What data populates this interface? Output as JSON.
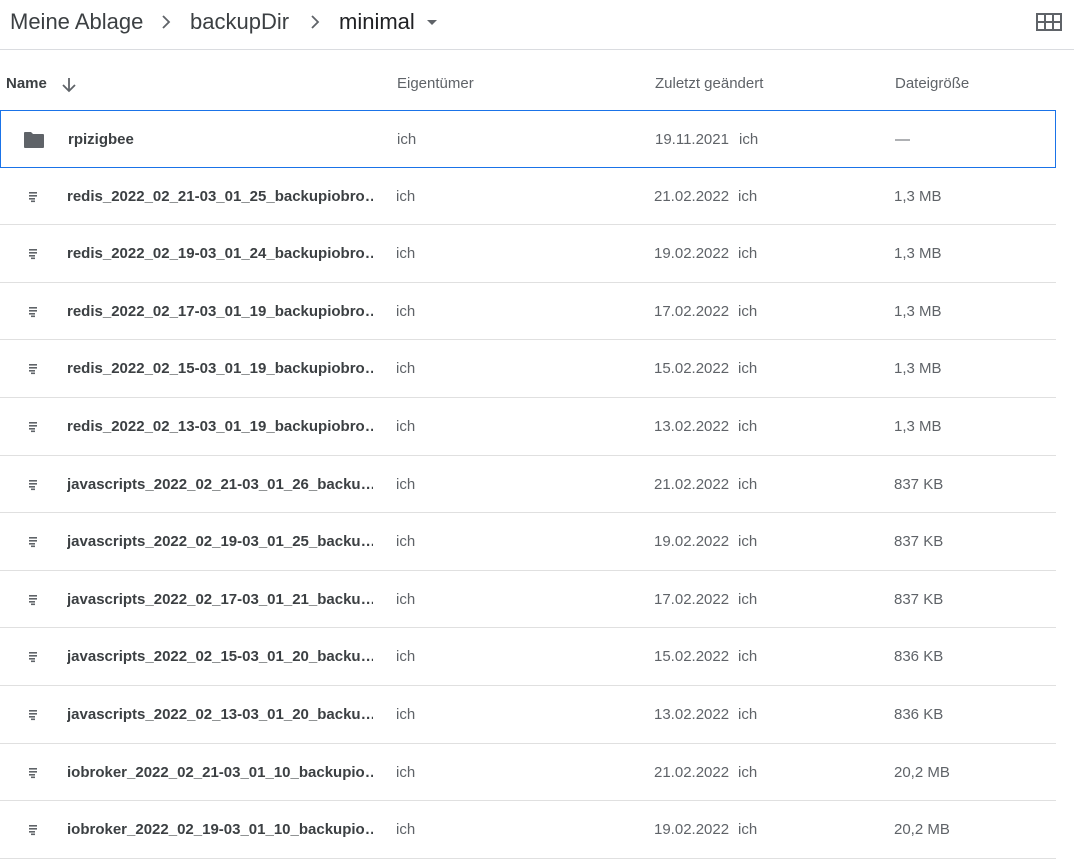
{
  "breadcrumb": {
    "items": [
      "Meine Ablage",
      "backupDir",
      "minimal"
    ]
  },
  "icons": {
    "separator": "chevron-right-icon",
    "dropdown": "caret-down-icon",
    "view_toggle": "grid-view-icon",
    "sort": "arrow-down-icon",
    "folder": "folder-icon",
    "file": "text-file-icon"
  },
  "colors": {
    "selection_border": "#1a73e8",
    "icon_gray": "#5f6368"
  },
  "columns": {
    "name": "Name",
    "owner": "Eigentümer",
    "modified": "Zuletzt geändert",
    "size": "Dateigröße"
  },
  "files": [
    {
      "type": "folder",
      "name": "rpizigbee",
      "owner": "ich",
      "date": "19.11.2021",
      "modified_by": "ich",
      "size": "—"
    },
    {
      "type": "file",
      "name": "redis_2022_02_21-03_01_25_backupiobro…",
      "owner": "ich",
      "date": "21.02.2022",
      "modified_by": "ich",
      "size": "1,3 MB"
    },
    {
      "type": "file",
      "name": "redis_2022_02_19-03_01_24_backupiobro…",
      "owner": "ich",
      "date": "19.02.2022",
      "modified_by": "ich",
      "size": "1,3 MB"
    },
    {
      "type": "file",
      "name": "redis_2022_02_17-03_01_19_backupiobro…",
      "owner": "ich",
      "date": "17.02.2022",
      "modified_by": "ich",
      "size": "1,3 MB"
    },
    {
      "type": "file",
      "name": "redis_2022_02_15-03_01_19_backupiobro…",
      "owner": "ich",
      "date": "15.02.2022",
      "modified_by": "ich",
      "size": "1,3 MB"
    },
    {
      "type": "file",
      "name": "redis_2022_02_13-03_01_19_backupiobro…",
      "owner": "ich",
      "date": "13.02.2022",
      "modified_by": "ich",
      "size": "1,3 MB"
    },
    {
      "type": "file",
      "name": "javascripts_2022_02_21-03_01_26_backu…",
      "owner": "ich",
      "date": "21.02.2022",
      "modified_by": "ich",
      "size": "837 KB"
    },
    {
      "type": "file",
      "name": "javascripts_2022_02_19-03_01_25_backu…",
      "owner": "ich",
      "date": "19.02.2022",
      "modified_by": "ich",
      "size": "837 KB"
    },
    {
      "type": "file",
      "name": "javascripts_2022_02_17-03_01_21_backu…",
      "owner": "ich",
      "date": "17.02.2022",
      "modified_by": "ich",
      "size": "837 KB"
    },
    {
      "type": "file",
      "name": "javascripts_2022_02_15-03_01_20_backu…",
      "owner": "ich",
      "date": "15.02.2022",
      "modified_by": "ich",
      "size": "836 KB"
    },
    {
      "type": "file",
      "name": "javascripts_2022_02_13-03_01_20_backu…",
      "owner": "ich",
      "date": "13.02.2022",
      "modified_by": "ich",
      "size": "836 KB"
    },
    {
      "type": "file",
      "name": "iobroker_2022_02_21-03_01_10_backupio…",
      "owner": "ich",
      "date": "21.02.2022",
      "modified_by": "ich",
      "size": "20,2 MB"
    },
    {
      "type": "file",
      "name": "iobroker_2022_02_19-03_01_10_backupio…",
      "owner": "ich",
      "date": "19.02.2022",
      "modified_by": "ich",
      "size": "20,2 MB"
    }
  ]
}
